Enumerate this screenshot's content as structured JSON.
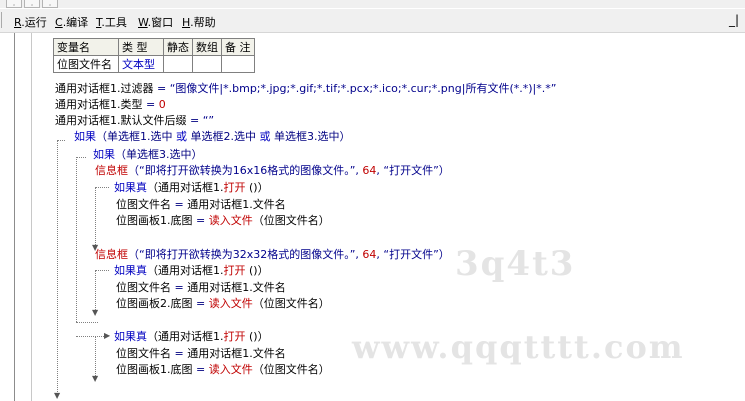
{
  "toolbar_icons": [
    "toolbar-icon-1",
    "toolbar-icon-2",
    "toolbar-icon-3"
  ],
  "menu": {
    "items": [
      {
        "key": "R",
        "label": ".运行"
      },
      {
        "key": "C",
        "label": ".编译"
      },
      {
        "key": "T",
        "label": ".工具"
      },
      {
        "key": "W",
        "label": ".窗口"
      },
      {
        "key": "H",
        "label": ".帮助"
      }
    ],
    "right": "_|"
  },
  "var_table": {
    "headers": [
      "变量名",
      "类 型",
      "静态",
      "数组",
      "备 注"
    ],
    "row": [
      "位图文件名",
      "文本型",
      "",
      "",
      ""
    ]
  },
  "code": {
    "l1": {
      "obj": "通用对话框1.过滤器",
      "op": " = ",
      "val": "“图像文件|*.bmp;*.jpg;*.gif;*.tif;*.pcx;*.ico;*.cur;*.png|所有文件(*.*)|*.*”"
    },
    "l2": {
      "obj": "通用对话框1.类型",
      "op": " = ",
      "val": "0"
    },
    "l3": {
      "obj": "通用对话框1.默认文件后缀",
      "op": " = ",
      "val": "“”"
    },
    "l4": {
      "kw": "如果",
      "text": "（单选框1.选中 ",
      "or1": "或",
      "text2": " 单选框2.选中 ",
      "or2": "或",
      "text3": " 单选框3.选中）"
    },
    "l5": {
      "kw": "如果",
      "text": "（单选框3.选中）"
    },
    "l6": {
      "fn": "信息框",
      "text": "（“即将打开欲转换为16x16格式的图像文件。”, ",
      "num": "64",
      "text2": ", “打开文件”）"
    },
    "l7": {
      "kw": "如果真",
      "text": "（通用对话框1.",
      "fn": "打开",
      "text2": " ()）"
    },
    "l8": {
      "obj": "位图文件名",
      "op": " = ",
      "val": "通用对话框1.文件名"
    },
    "l9": {
      "obj": "位图画板1.底图",
      "op": " = ",
      "fn": "读入文件",
      "val": "（位图文件名）"
    },
    "l10": {
      "fn": "信息框",
      "text": "（“即将打开欲转换为32x32格式的图像文件。”, ",
      "num": "64",
      "text2": ", “打开文件”）"
    },
    "l11": {
      "kw": "如果真",
      "text": "（通用对话框1.",
      "fn": "打开",
      "text2": " ()）"
    },
    "l12": {
      "obj": "位图文件名",
      "op": " = ",
      "val": "通用对话框1.文件名"
    },
    "l13": {
      "obj": "位图画板2.底图",
      "op": " = ",
      "fn": "读入文件",
      "val": "（位图文件名）"
    },
    "l14": {
      "kw": "如果真",
      "text": "（通用对话框1.",
      "fn": "打开",
      "text2": " ()）"
    },
    "l15": {
      "obj": "位图文件名",
      "op": " = ",
      "val": "通用对话框1.文件名"
    },
    "l16": {
      "obj": "位图画板1.底图",
      "op": " = ",
      "fn": "读入文件",
      "val": "（位图文件名）"
    }
  },
  "watermark": {
    "line1": "3q4t3",
    "line2": "www.qqqtttt.com"
  }
}
